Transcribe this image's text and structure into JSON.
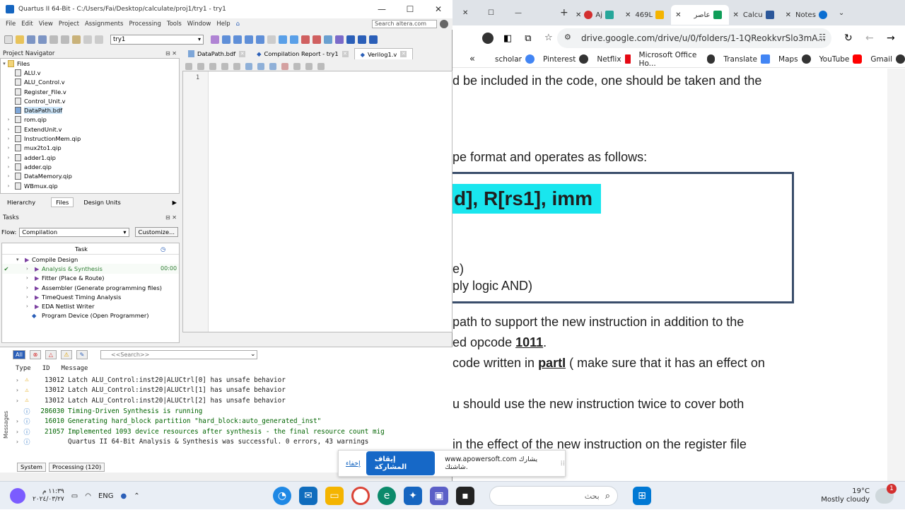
{
  "quartus": {
    "title": "Quartus II 64-Bit - C:/Users/Fai/Desktop/calculate/proj1/try1 - try1",
    "menu": [
      "File",
      "Edit",
      "View",
      "Project",
      "Assignments",
      "Processing",
      "Tools",
      "Window",
      "Help"
    ],
    "search_placeholder": "Search altera.com",
    "project_select": "try1",
    "project_navigator": {
      "title": "Project Navigator",
      "root": "Files",
      "files": [
        "ALU.v",
        "ALU_Control.v",
        "Register_File.v",
        "Control_Unit.v",
        "DataPath.bdf",
        "rom.qip",
        "ExtendUnit.v",
        "InstructionMem.qip",
        "mux2to1.qip",
        "adder1.qip",
        "adder.qip",
        "DataMemory.qip",
        "WBmux.qip"
      ],
      "tabs": [
        "Hierarchy",
        "Files",
        "Design Units"
      ]
    },
    "tasks": {
      "title": "Tasks",
      "flow_label": "Flow:",
      "flow_value": "Compilation",
      "customize": "Customize...",
      "column": "Task",
      "rows": [
        {
          "label": "Compile Design",
          "time": ""
        },
        {
          "label": "Analysis & Synthesis",
          "time": "00:00"
        },
        {
          "label": "Fitter (Place & Route)",
          "time": ""
        },
        {
          "label": "Assembler (Generate programming files)",
          "time": ""
        },
        {
          "label": "TimeQuest Timing Analysis",
          "time": ""
        },
        {
          "label": "EDA Netlist Writer",
          "time": ""
        },
        {
          "label": "Program Device (Open Programmer)",
          "time": ""
        }
      ]
    },
    "editor_tabs": [
      "DataPath.bdf",
      "Compilation Report - try1",
      "Verilog1.v"
    ],
    "editor_line": "1",
    "messages": {
      "filter_all": "All",
      "search_placeholder": "<<Search>>",
      "columns": [
        "Type",
        "ID",
        "Message"
      ],
      "lines": [
        {
          "type": "warn",
          "id": "13012",
          "text": "Latch ALU_Control:inst20|ALUCtrl[0] has unsafe behavior"
        },
        {
          "type": "warn",
          "id": "13012",
          "text": "Latch ALU_Control:inst20|ALUCtrl[1] has unsafe behavior"
        },
        {
          "type": "warn",
          "id": "13012",
          "text": "Latch ALU_Control:inst20|ALUCtrl[2] has unsafe behavior"
        },
        {
          "type": "info",
          "id": "286030",
          "text": "Timing-Driven Synthesis is running"
        },
        {
          "type": "info",
          "id": "16010",
          "text": "Generating hard_block partition \"hard_block:auto_generated_inst\""
        },
        {
          "type": "info",
          "id": "21057",
          "text": "Implemented 1093 device resources after synthesis - the final resource count mig"
        },
        {
          "type": "info",
          "id": "",
          "text": "Quartus II 64-Bit Analysis & Synthesis was successful. 0 errors, 43 warnings"
        }
      ],
      "bottom_tabs": [
        "System",
        "Processing (120)"
      ],
      "side_label": "Messages"
    }
  },
  "chrome": {
    "tabs": [
      "Aj",
      "469L",
      "عاصر",
      "Calcu",
      "Notes"
    ],
    "url": "drive.google.com/drive/u/0/folders/1-1QReokkvrSlo3mA...",
    "bookmarks": [
      "scholar",
      "Pinterest",
      "Netflix",
      "Microsoft Office Ho...",
      "Translate",
      "Maps",
      "YouTube",
      "Gmail"
    ],
    "doc_lines": [
      "d be included in the code, one should be taken and the",
      "pe format and operates as follows:",
      "d], R[rs1], imm",
      "e)",
      "ply logic AND)",
      "path to support the new instruction in addition to the",
      "ed opcode ",
      "1011",
      ".",
      "code written in ",
      "partI",
      "  ( make sure that it has an effect on",
      "u should use the new instruction twice to cover both",
      "in the effect of the new instruction on the register file"
    ]
  },
  "share_bar": {
    "hide": "إخفاء",
    "stop": "إيقاف المشاركة",
    "message": "www.apowersoft.com يشارك شاشتك."
  },
  "taskbar": {
    "time": "١١:٣٩ م",
    "date": "٢٠٢٤/٠٣/٢٧",
    "lang": "ENG",
    "search": "بحث",
    "weather_temp": "19°C",
    "weather_desc": "Mostly cloudy",
    "notif_count": "1"
  },
  "colors": {
    "highlight": "#19e6ee",
    "stop_button": "#1668c7"
  }
}
